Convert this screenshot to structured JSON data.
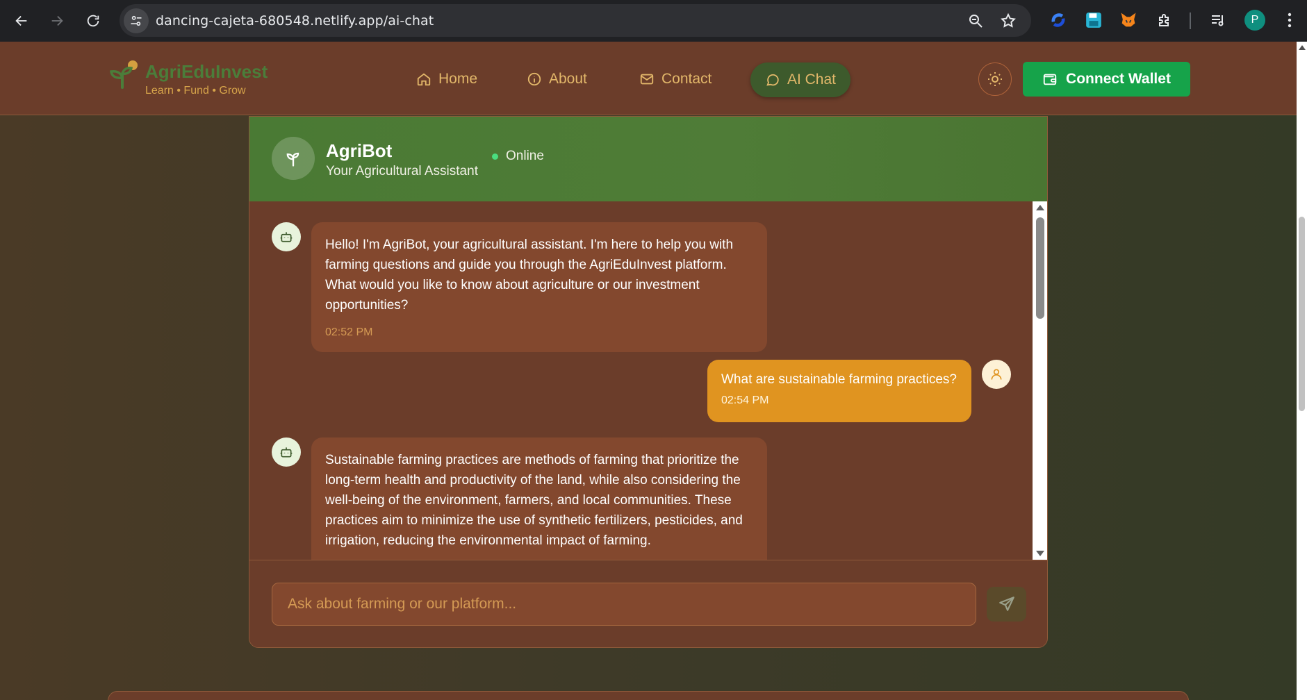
{
  "browser": {
    "url": "dancing-cajeta-680548.netlify.app/ai-chat",
    "profile_initial": "P"
  },
  "nav": {
    "brand": "AgriEduInvest",
    "tagline": "Learn • Fund • Grow",
    "links": [
      {
        "label": "Home",
        "icon": "home-icon"
      },
      {
        "label": "About",
        "icon": "info-icon"
      },
      {
        "label": "Contact",
        "icon": "mail-icon"
      },
      {
        "label": "AI Chat",
        "icon": "chat-bubble-icon",
        "active": true
      }
    ],
    "wallet_label": "Connect Wallet"
  },
  "chat": {
    "bot_name": "AgriBot",
    "bot_role": "Your Agricultural Assistant",
    "status": "Online",
    "messages": [
      {
        "from": "bot",
        "text": "Hello! I'm AgriBot, your agricultural assistant. I'm here to help you with farming questions and guide you through the AgriEduInvest platform. What would you like to know about agriculture or our investment opportunities?",
        "time": "02:52 PM"
      },
      {
        "from": "user",
        "text": "What are sustainable farming practices?",
        "time": "02:54 PM"
      },
      {
        "from": "bot",
        "text": "Sustainable farming practices are methods of farming that prioritize the long-term health and productivity of the land, while also considering the well-being of the environment, farmers, and local communities. These practices aim to minimize the use of synthetic fertilizers, pesticides, and irrigation, reducing the environmental impact of farming."
      }
    ],
    "input_placeholder": "Ask about farming or our platform..."
  },
  "colors": {
    "nav_bg": "#6b3d2a",
    "header_green": "#4f7c37",
    "bot_bubble": "#83482e",
    "user_bubble": "#e09420",
    "wallet_green": "#16a34a",
    "accent_gold": "#e3b86a"
  }
}
